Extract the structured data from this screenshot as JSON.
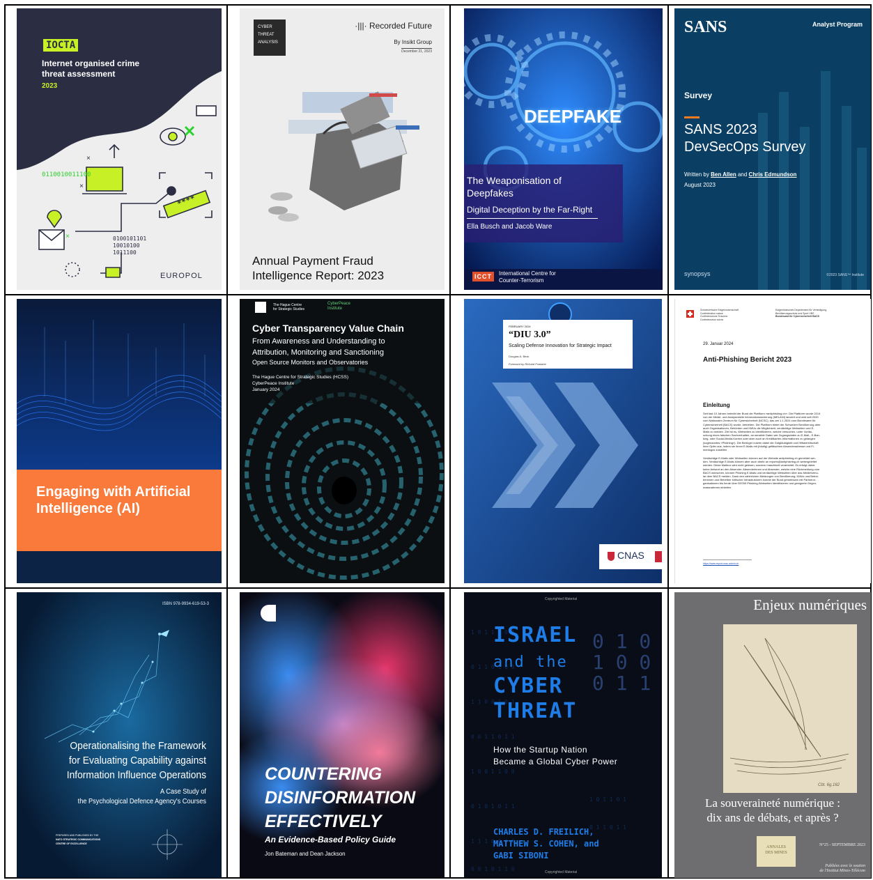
{
  "covers": {
    "iocta": {
      "badge": "IOCTA",
      "title_line1": "Internet organised crime",
      "title_line2": "threat assessment",
      "year": "2023",
      "binary1": "0110010011100",
      "binary2": "0100101101",
      "binary3": "10010100",
      "binary4": "1011100",
      "publisher": "EUROPOL",
      "password_mask": "****",
      "accent": "#c8f026"
    },
    "recorded_future": {
      "tag_line1": "CYBER",
      "tag_line2": "THREAT",
      "tag_line3": "ANALYSIS",
      "brand": "·|||· Recorded Future",
      "byline": "By Insikt Group",
      "date": "December 21, 2023",
      "title_line1": "Annual Payment Fraud",
      "title_line2": "Intelligence Report: 2023"
    },
    "deepfakes": {
      "banner": "DEEPFAKE",
      "title_line1": "The Weaponisation of",
      "title_line2": "Deepfakes",
      "subtitle": "Digital Deception by the Far-Right",
      "authors": "Ella Busch and Jacob Ware",
      "logo": "ICCT",
      "org_line1": "International Centre for",
      "org_line2": "Counter-Terrorism"
    },
    "sans": {
      "brand": "SANS",
      "program": "Analyst Program",
      "label": "Survey",
      "title_line1": "SANS 2023",
      "title_line2": "DevSecOps Survey",
      "written_prefix": "Written by",
      "author1": "Ben Allen",
      "and": "and",
      "author2": "Chris Edmundson",
      "date": "August 2023",
      "sponsor": "synopsys",
      "copyright": "©2023 SANS™ Institute"
    },
    "engaging_ai": {
      "title_line1": "Engaging with Artificial",
      "title_line2": "Intelligence (AI)"
    },
    "hcss": {
      "org1_line1": "The Hague Centre",
      "org1_line2": "for Strategic Studies",
      "org2_line1": "CyberPeace",
      "org2_line2": "Institute",
      "title": "Cyber Transparency Value Chain",
      "subtitle_line1": "From Awareness and Understanding to",
      "subtitle_line2": "Attribution, Monitoring and Sanctioning",
      "subtitle_line3": "Open Source Monitors and Observatories",
      "authors_line1": "The Hague Centre for Strategic Studies (HCSS)",
      "authors_line2": "CyberPeace Institute",
      "date": "January 2024"
    },
    "diu": {
      "date": "FEBRUARY 2024",
      "title": "“DIU 3.0”",
      "subtitle": "Scaling Defense Innovation for Strategic Impact",
      "author": "Douglas A. Beck",
      "foreword": "Foreword by Richard Fontaine",
      "logo": "CNAS"
    },
    "anti_phishing": {
      "hdr_left_line1": "Schweizerische Eidgenossenschaft",
      "hdr_left_line2": "Confédération suisse",
      "hdr_left_line3": "Confederazione Svizzera",
      "hdr_left_line4": "Confederaziun svizra",
      "hdr_right_line1": "Eidgenössisches Departement für Verteidigung,",
      "hdr_right_line2": "Bevölkerungsschutz und Sport VBS",
      "hdr_right_line3": "Bundesamt für Cybersicherheit BACS",
      "date": "29. Januar 2024",
      "title": "Anti-Phishing Bericht 2023",
      "section": "Einleitung",
      "para1": [
        "Seit fast 10 Jahren betreibt der Bund die Plattform «antiphishing.ch». Die Plattform wurde 2014",
        "von der Melde- und Analysestelle Informationssicherung (MELANI) lanciert und wird seit 2020",
        "vom Nationalen Zentrum für Cybersicherheit (NCSC), das am 1.1.2024 zum Bundesamt für",
        "Cybersicherheit (BACS) wurde, betrieben. Die Plattform bietet der Schweizer Bevölkerung aber",
        "auch Organisationen, Behörden und KMUs die Möglichkeit, verdächtige Webseiten und E-",
        "Mails zu melden. Ziel ist es, Webseiten zu identifizieren, welche versuchen, unter Vortäu-",
        "schung eines falschen Sachverhalten, an sensible Daten wie Zugangsdaten zu E-Mail-, E-Ban-",
        "king- oder Social-Media-Konten oder aber auch an Kreditkarten-Informationen zu gelangen",
        "(sogenanntes «Phishing»). Die Betrüger nutzen dabei die Gutgläubigkeit und Hilfsbereitschaft",
        "ihrer Opfer aus, indem sie ihnen E-Mails mit (häufig) gefälschten Absenderadresse und Fi-",
        "menlogos zustellen."
      ],
      "para2": [
        "Verdächtige E-Mails oder Webseiten können auf der Website antiphishing.ch gemeldet wer-",
        "den. Verdächtige E-Mails können aber auch direkt an reports@antiphishing.ch weitergeleitet",
        "werden. Diese Mailbox wird nicht gelesen, sondern maschinell verarbeitet. Es erfolgt daher",
        "keine Antwort an den Absender. Absenderinnen und Absender, welche eine Rückmeldung vom",
        "BACS wünschen, können Phishing E-Mails und verdächtige Webseiten über das Meldeformu-",
        "lar dem BACS melden. Dank den zahlreichen Meldungen von Bevölkerung, KMUs und Betrei-",
        "berinnen und Betreiber kritischer Infrastrukturen konnte der Bund gemeinsam mit Partneror-",
        "ganisationen bis heute über 55'000 Phishing-Webseiten identifizieren und geeignete Gegen-",
        "massnahmen einleiten."
      ],
      "footer": "https://www.report.ncsc.admin.ch"
    },
    "nato": {
      "isbn": "ISBN 978-9934-619-53-3",
      "title_line1": "Operationalising the Framework",
      "title_line2": "for Evaluating Capability against",
      "title_line3": "Information Influence Operations",
      "sub_line1": "A Case Study of",
      "sub_line2": "the Psychological Defence Agency's Courses",
      "pub_line1": "PREPARED AND PUBLISHED BY THE",
      "pub_line2": "NATO STRATEGIC COMMUNICATIONS",
      "pub_line3": "CENTRE OF EXCELLENCE"
    },
    "countering": {
      "title_line1": "COUNTERING",
      "title_line2": "DISINFORMATION",
      "title_line3": "EFFECTIVELY",
      "subtitle": "An Evidence-Based Policy Guide",
      "authors": "Jon Bateman and Dean Jackson"
    },
    "israel": {
      "top": "Copyrighted Material",
      "title_line1": "ISRAEL",
      "title_line2": "and the",
      "title_line3": "CYBER",
      "title_line4": "THREAT",
      "subtitle_line1": "How the Startup Nation",
      "subtitle_line2": "Became a Global Cyber Power",
      "authors_line1": "CHARLES D. FREILICH,",
      "authors_line2": "MATTHEW S. COHEN, and",
      "authors_line3": "GABI SIBONI",
      "bottom": "Copyrighted Material",
      "digits1": "0 1 0",
      "digits2": "1 0 0",
      "digits3": "0 1 1"
    },
    "enjeux": {
      "header": "Enjeux numériques",
      "sketch_note": "Cbt. 6g.162",
      "title_line1": "La souveraineté numérique :",
      "title_line2": "dix ans de débats, et après ?",
      "logo_line1": "ANNALES",
      "logo_line2": "DES MINES",
      "issue": "N°25 - SEPTEMBRE 2023",
      "credit_line1": "Publiées avec le soutien",
      "credit_line2": "de l'Institut Mines-Télécom"
    }
  }
}
